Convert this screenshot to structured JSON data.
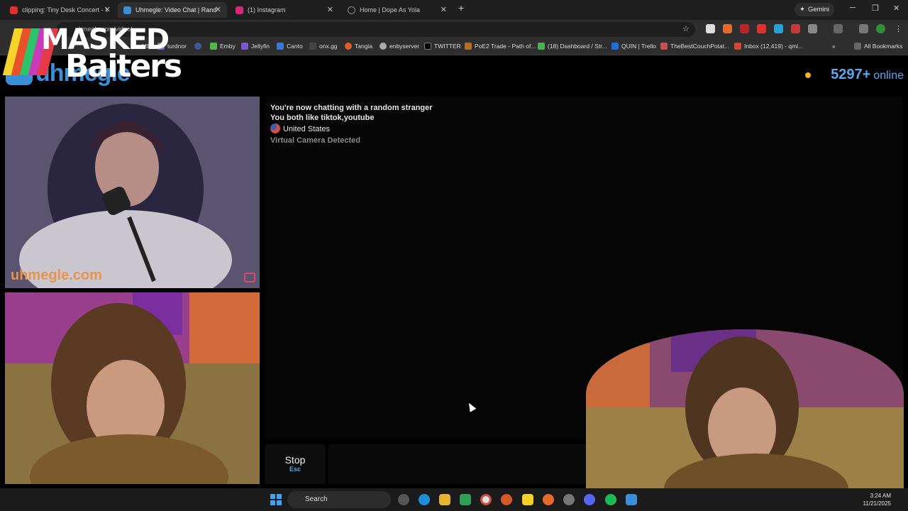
{
  "browser": {
    "tabs": [
      {
        "label": "clipping: Tiny Desk Concert - Y",
        "color": "#e0312e",
        "active": false
      },
      {
        "label": "Uhmegle: Video Chat | Rand",
        "color": "#3b8fd6",
        "active": true
      },
      {
        "label": "(1) Instagram",
        "color": "#d6287a",
        "active": false
      },
      {
        "label": "Home | Dope As Yola",
        "color": "#555555",
        "active": false
      }
    ],
    "new_tab": "+",
    "gemini_label": "Gemini",
    "url": "uhmegle.com/video/",
    "bookmarks": [
      {
        "label": "ME",
        "color": "#888888"
      },
      {
        "label": "turdnor",
        "color": "#8a5fd6"
      },
      {
        "label": "",
        "color": "#3b5998"
      },
      {
        "label": "Emby",
        "color": "#52b54b"
      },
      {
        "label": "Jellyfin",
        "color": "#7b57c9"
      },
      {
        "label": "Canto",
        "color": "#3a77d6"
      },
      {
        "label": "onx.gg",
        "color": "#444444"
      },
      {
        "label": "Tangia",
        "color": "#e05a2b"
      },
      {
        "label": "enbyserver",
        "color": "#aaaaaa"
      },
      {
        "label": "TWITTER",
        "color": "#000000"
      },
      {
        "label": "PoE2 Trade - Path of...",
        "color": "#b56d2a"
      },
      {
        "label": "(18) Dashboard / Str...",
        "color": "#4caf50"
      },
      {
        "label": "QUIN | Trello",
        "color": "#1f6fd6"
      },
      {
        "label": "TheBestCouchPotat...",
        "color": "#c44e4e"
      },
      {
        "label": "Inbox (12,419) - qmi...",
        "color": "#d44638"
      }
    ],
    "all_bookmarks": "All Bookmarks"
  },
  "overlay_logo": {
    "line1": "MASKED",
    "line2": "Baiters",
    "stripe_colors": [
      "#f4d32b",
      "#e8512a",
      "#2cc36b",
      "#c73ab8",
      "#e53a4a"
    ]
  },
  "site": {
    "logo_text": "uhmegle",
    "online_count": "5297+",
    "online_label": "online",
    "watermark": "uhmegle.com"
  },
  "chat": {
    "line1": "You're now chatting with a random stranger",
    "line2": "You both like tiktok,youtube",
    "country": "United States",
    "virtual_camera": "Virtual Camera Detected"
  },
  "controls": {
    "stop_label": "Stop",
    "stop_shortcut": "Esc"
  },
  "taskbar": {
    "search_placeholder": "Search",
    "time": "3:24 AM",
    "date": "11/21/2025"
  }
}
